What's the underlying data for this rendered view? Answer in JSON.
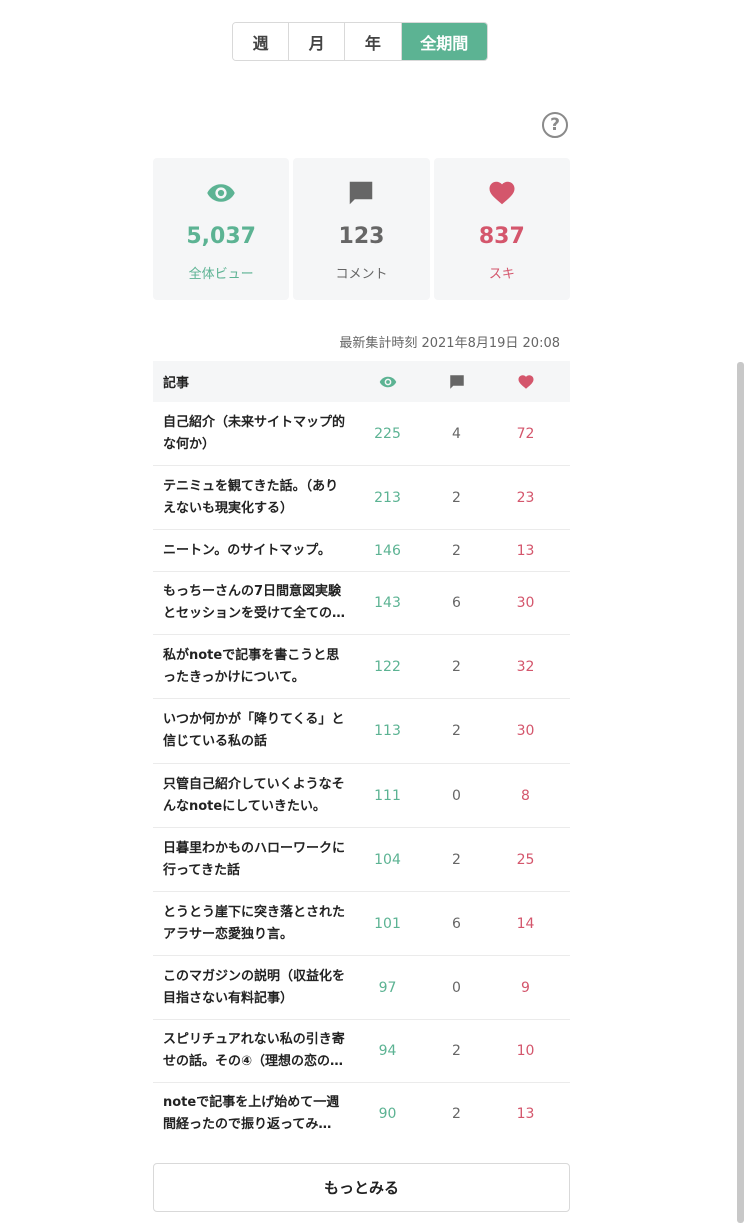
{
  "period_tabs": [
    {
      "label": "週"
    },
    {
      "label": "月"
    },
    {
      "label": "年"
    },
    {
      "label": "全期間"
    }
  ],
  "active_tab": "全期間",
  "help": {
    "glyph": "?"
  },
  "summary": {
    "views": {
      "value": "5,037",
      "label": "全体ビュー",
      "icon": "eye-icon"
    },
    "comments": {
      "value": "123",
      "label": "コメント",
      "icon": "comment-icon"
    },
    "likes": {
      "value": "837",
      "label": "スキ",
      "icon": "heart-icon"
    }
  },
  "timestamp": "最新集計時刻 2021年8月19日 20:08",
  "table": {
    "header_title": "記事",
    "rows": [
      {
        "title": "自己紹介（未来サイトマップ的な何か）",
        "views": "225",
        "comments": "4",
        "likes": "72"
      },
      {
        "title": "テニミュを観てきた話。（ありえないも現実化する）",
        "views": "213",
        "comments": "2",
        "likes": "23"
      },
      {
        "title": "ニートン。のサイトマップ。",
        "views": "146",
        "comments": "2",
        "likes": "13"
      },
      {
        "title": "もっちーさんの7日間意図実験とセッションを受けて全ての…",
        "views": "143",
        "comments": "6",
        "likes": "30"
      },
      {
        "title": "私がnoteで記事を書こうと思ったきっかけについて。",
        "views": "122",
        "comments": "2",
        "likes": "32"
      },
      {
        "title": "いつか何かが「降りてくる」と信じている私の話",
        "views": "113",
        "comments": "2",
        "likes": "30"
      },
      {
        "title": "只管自己紹介していくようなそんなnoteにしていきたい。",
        "views": "111",
        "comments": "0",
        "likes": "8"
      },
      {
        "title": "日暮里わかものハローワークに行ってきた話",
        "views": "104",
        "comments": "2",
        "likes": "25"
      },
      {
        "title": "とうとう崖下に突き落とされたアラサー恋愛独り言。",
        "views": "101",
        "comments": "6",
        "likes": "14"
      },
      {
        "title": "このマガジンの説明（収益化を目指さない有料記事）",
        "views": "97",
        "comments": "0",
        "likes": "9"
      },
      {
        "title": "スピリチュアれない私の引き寄せの話。その④（理想の恋の…",
        "views": "94",
        "comments": "2",
        "likes": "10"
      },
      {
        "title": "noteで記事を上げ始めて一週間経ったので振り返ってみ…",
        "views": "90",
        "comments": "2",
        "likes": "13"
      }
    ]
  },
  "more_button": "もっとみる",
  "colors": {
    "accent": "#5cb393",
    "like": "#d4566c",
    "comment": "#666666"
  }
}
